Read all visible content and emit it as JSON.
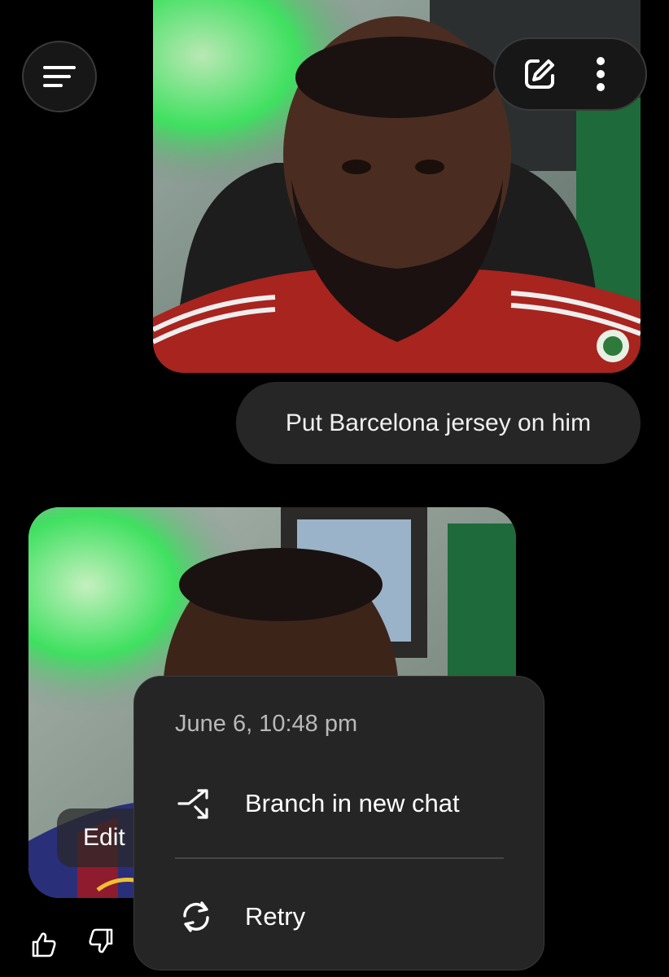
{
  "top_bar": {
    "menu_icon": "menu-icon",
    "new_chat_icon": "compose-icon",
    "more_icon": "more-vertical-icon"
  },
  "messages": {
    "user_prompt": "Put Barcelona jersey on him"
  },
  "result": {
    "edit_label": "Edit"
  },
  "feedback": {
    "like_icon": "thumbs-up-icon",
    "dislike_icon": "thumbs-down-icon"
  },
  "context_menu": {
    "timestamp": "June 6, 10:48 pm",
    "items": [
      {
        "label": "Branch in new chat",
        "icon": "branch-icon"
      },
      {
        "label": "Retry",
        "icon": "retry-icon"
      }
    ]
  },
  "colors": {
    "background": "#000000",
    "bubble": "#262626",
    "menu": "#252525",
    "accent_green": "#3fe060",
    "jersey_red": "#a8241f",
    "barca_blue": "#2a2f7a",
    "barca_garnet": "#8e1b2e"
  }
}
